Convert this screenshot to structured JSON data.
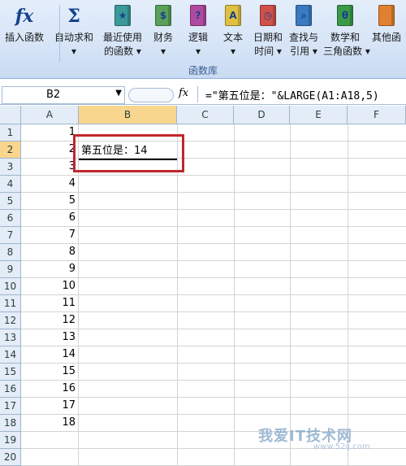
{
  "ribbon": {
    "buttons": [
      {
        "id": "insert-function",
        "line1": "插入函数",
        "line2": "",
        "icon": "fx-icon",
        "glyph": "fx",
        "color": "#1a1a1a"
      },
      {
        "id": "autosum",
        "line1": "自动求和",
        "line2": "▾",
        "icon": "sigma-icon",
        "glyph": "Σ",
        "color": "#1a1a1a"
      },
      {
        "id": "recent",
        "line1": "最近使用",
        "line2": "的函数 ▾",
        "icon": "recent-book-icon",
        "glyph": "★",
        "color": "#3a9a9a"
      },
      {
        "id": "financial",
        "line1": "财务",
        "line2": "▾",
        "icon": "financial-book-icon",
        "glyph": "$",
        "color": "#5aa05a"
      },
      {
        "id": "logical",
        "line1": "逻辑",
        "line2": "▾",
        "icon": "logical-book-icon",
        "glyph": "?",
        "color": "#b04aa0"
      },
      {
        "id": "text",
        "line1": "文本",
        "line2": "▾",
        "icon": "text-book-icon",
        "glyph": "A",
        "color": "#e0c040"
      },
      {
        "id": "datetime",
        "line1": "日期和",
        "line2": "时间 ▾",
        "icon": "datetime-book-icon",
        "glyph": "◷",
        "color": "#d0504a"
      },
      {
        "id": "lookup",
        "line1": "查找与",
        "line2": "引用 ▾",
        "icon": "lookup-book-icon",
        "glyph": "⌕",
        "color": "#3a7ac0"
      },
      {
        "id": "math",
        "line1": "数学和",
        "line2": "三角函数 ▾",
        "icon": "math-book-icon",
        "glyph": "θ",
        "color": "#3a9a4a"
      },
      {
        "id": "more",
        "line1": "其他函",
        "line2": "",
        "icon": "more-book-icon",
        "glyph": "",
        "color": "#e08030"
      }
    ],
    "group_label": "函数库"
  },
  "formula_bar": {
    "name_box": "B2",
    "fx": "fx",
    "formula": "=\"第五位是：\"&LARGE(A1:A18,5)"
  },
  "columns": [
    "A",
    "B",
    "C",
    "D",
    "E",
    "F"
  ],
  "selected_column": "B",
  "selected_row": "2",
  "rows": [
    {
      "n": "1",
      "a": "1"
    },
    {
      "n": "2",
      "a": "2"
    },
    {
      "n": "3",
      "a": "3"
    },
    {
      "n": "4",
      "a": "4"
    },
    {
      "n": "5",
      "a": "5"
    },
    {
      "n": "6",
      "a": "6"
    },
    {
      "n": "7",
      "a": "7"
    },
    {
      "n": "8",
      "a": "8"
    },
    {
      "n": "9",
      "a": "9"
    },
    {
      "n": "10",
      "a": "10"
    },
    {
      "n": "11",
      "a": "11"
    },
    {
      "n": "12",
      "a": "12"
    },
    {
      "n": "13",
      "a": "13"
    },
    {
      "n": "14",
      "a": "14"
    },
    {
      "n": "15",
      "a": "15"
    },
    {
      "n": "16",
      "a": "16"
    },
    {
      "n": "17",
      "a": "17"
    },
    {
      "n": "18",
      "a": "18"
    },
    {
      "n": "19",
      "a": ""
    },
    {
      "n": "20",
      "a": ""
    }
  ],
  "b2_value": "第五位是：14",
  "watermark": "我爱IT技术网",
  "watermark_sub": "www.52ij.com"
}
